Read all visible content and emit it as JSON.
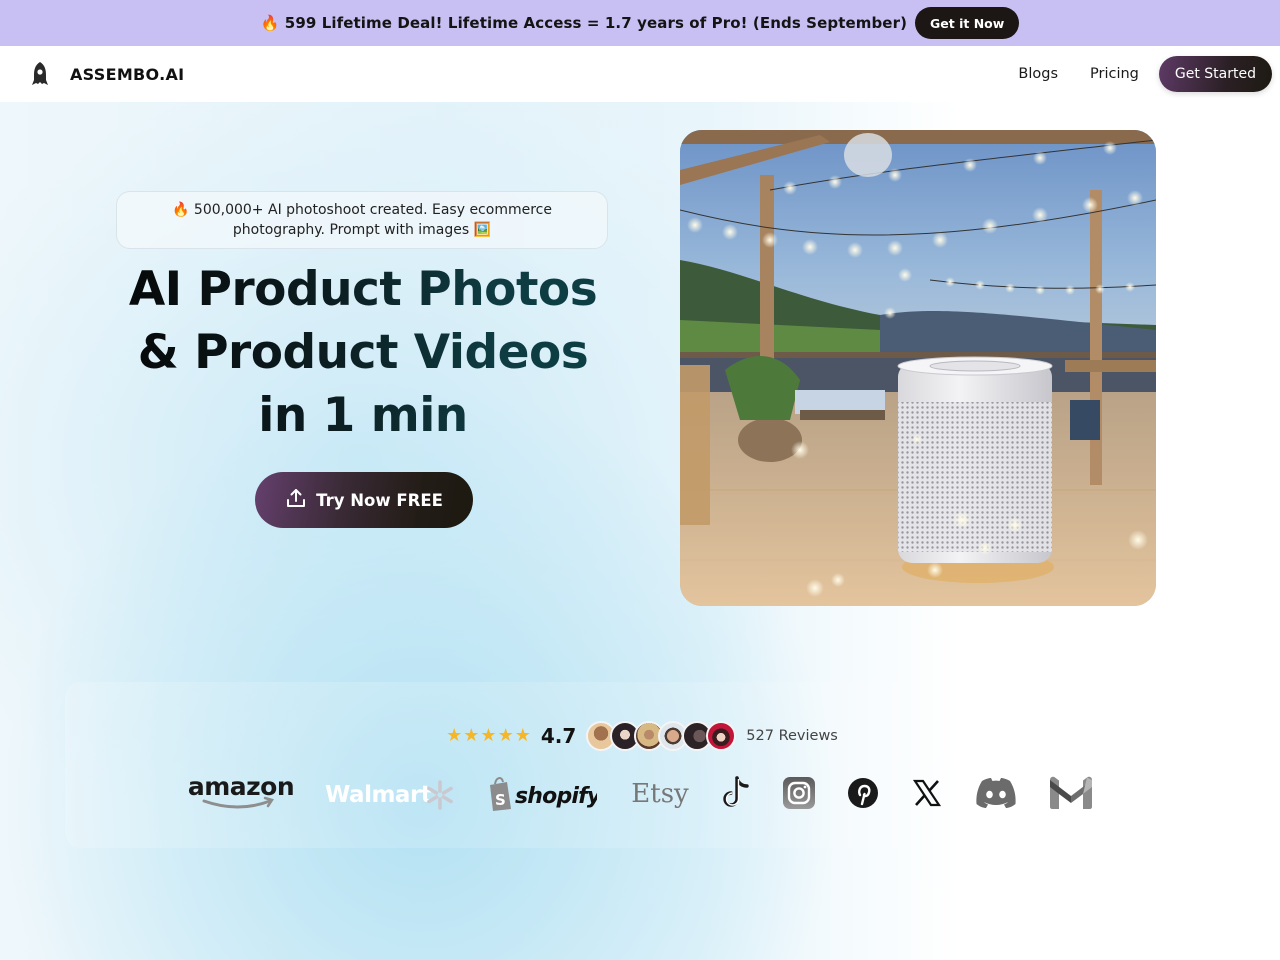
{
  "promo": {
    "icon": "fire-emoji",
    "text": "🔥 599 Lifetime Deal! Lifetime Access = 1.7 years of Pro! (Ends September)",
    "button_label": "Get it Now"
  },
  "nav": {
    "brand_icon": "rocket-icon",
    "brand_name": "ASSEMBO.AI",
    "links": [
      {
        "label": "Blogs"
      },
      {
        "label": "Pricing"
      }
    ],
    "cta_label": "Get Started"
  },
  "hero": {
    "announcement": "🔥 500,000+ AI photoshoot created. Easy ecommerce photography. Prompt with images 🖼️",
    "headline_lines": [
      "AI Product Photos",
      "& Product Videos",
      "in 1 min"
    ],
    "cta_icon": "upload-icon",
    "cta_label": "Try Now FREE",
    "image_alt": "White cylindrical air purifier on a wooden deck at dusk with string lights",
    "brand_colors": {
      "promo_bg": "#c8bff3",
      "cta_gradient_start": "#65406e",
      "cta_gradient_end": "#1c1910",
      "headline_accent": "#0e3c42",
      "star": "#f5b728"
    }
  },
  "social_proof": {
    "stars": 5,
    "rating": "4.7",
    "avatars": [
      "reviewer-1",
      "reviewer-2",
      "reviewer-3",
      "reviewer-4",
      "reviewer-5",
      "reviewer-6"
    ],
    "reviews_label": "527 Reviews",
    "logos": [
      {
        "name": "amazon",
        "label": "amazon"
      },
      {
        "name": "walmart",
        "label": "Walmart"
      },
      {
        "name": "shopify",
        "label": "shopify"
      },
      {
        "name": "etsy",
        "label": "Etsy"
      },
      {
        "name": "tiktok",
        "label": "TikTok"
      },
      {
        "name": "instagram",
        "label": "Instagram"
      },
      {
        "name": "pinterest",
        "label": "Pinterest"
      },
      {
        "name": "x",
        "label": "X"
      },
      {
        "name": "discord",
        "label": "Discord"
      },
      {
        "name": "gmail",
        "label": "Gmail"
      }
    ]
  }
}
